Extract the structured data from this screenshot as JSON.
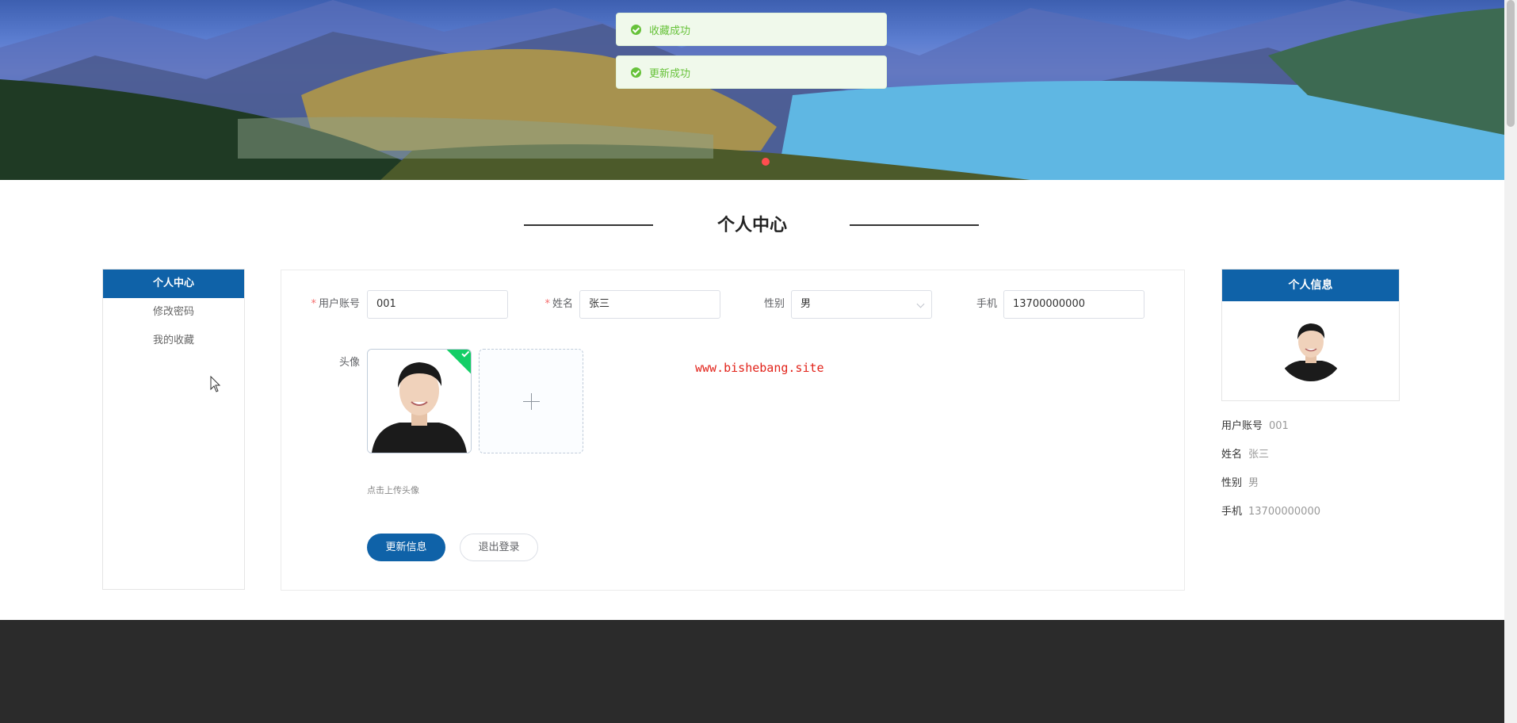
{
  "toasts": [
    {
      "text": "收藏成功"
    },
    {
      "text": "更新成功"
    }
  ],
  "section_title": "个人中心",
  "sidebar": {
    "items": [
      {
        "label": "个人中心",
        "active": true
      },
      {
        "label": "修改密码",
        "active": false
      },
      {
        "label": "我的收藏",
        "active": false
      }
    ]
  },
  "form": {
    "account": {
      "label": "用户账号",
      "value": "001",
      "required": true
    },
    "name": {
      "label": "姓名",
      "value": "张三",
      "required": true
    },
    "gender": {
      "label": "性别",
      "value": "男"
    },
    "phone": {
      "label": "手机",
      "value": "13700000000"
    },
    "avatar": {
      "label": "头像",
      "tip": "点击上传头像"
    },
    "update_button": "更新信息",
    "logout_button": "退出登录"
  },
  "watermark": "www.bishebang.site",
  "profile": {
    "title": "个人信息",
    "rows": [
      {
        "label": "用户账号",
        "value": "001"
      },
      {
        "label": "姓名",
        "value": "张三"
      },
      {
        "label": "性别",
        "value": "男"
      },
      {
        "label": "手机",
        "value": "13700000000"
      }
    ]
  },
  "colors": {
    "primary": "#0f62a8",
    "success": "#67c23a",
    "footer": "#2b2b2b",
    "watermark": "#e2231a"
  }
}
